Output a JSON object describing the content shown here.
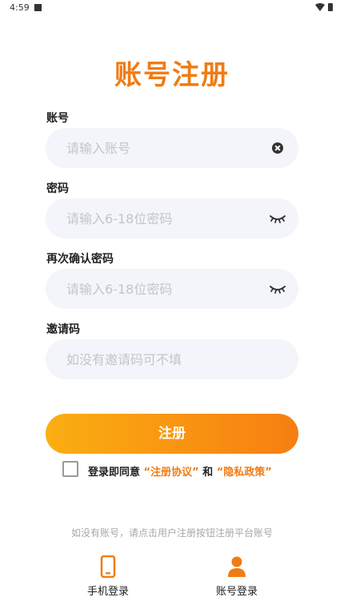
{
  "status_bar": {
    "time": "4:59"
  },
  "title": "账号注册",
  "fields": {
    "account": {
      "label": "账号",
      "placeholder": "请输入账号"
    },
    "password": {
      "label": "密码",
      "placeholder": "请输入6-18位密码"
    },
    "confirm_password": {
      "label": "再次确认密码",
      "placeholder": "请输入6-18位密码"
    },
    "invite_code": {
      "label": "邀请码",
      "placeholder": "如没有邀请码可不填"
    }
  },
  "register_button": "注册",
  "agreement": {
    "prefix": "登录即同意 ",
    "terms_link": "“注册协议”",
    "connector": " 和 ",
    "privacy_link": "“隐私政策”",
    "checked": false
  },
  "hint": "如没有账号，请点击用户注册按钮注册平台账号",
  "bottom_tabs": {
    "phone_login": {
      "label": "手机登录",
      "icon": "phone-icon"
    },
    "account_login": {
      "label": "账号登录",
      "icon": "user-icon"
    }
  },
  "colors": {
    "accent": "#f07c14",
    "gradient_start": "#fbae12",
    "gradient_end": "#f77e12",
    "input_bg": "#f4f4fb"
  }
}
